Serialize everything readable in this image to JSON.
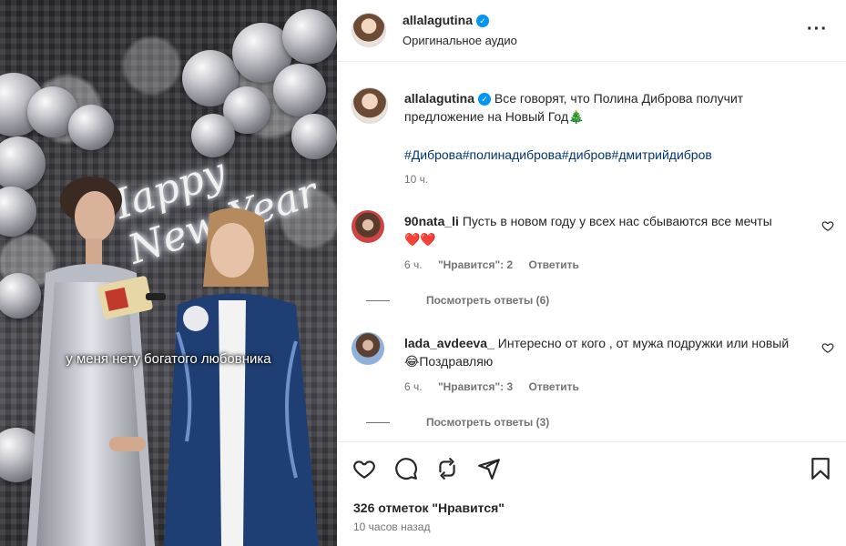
{
  "post": {
    "username": "allalagutina",
    "audio": "Оригинальное аудио",
    "video_caption": "у меня нету богатого любовника",
    "neon_sign": [
      "Happy",
      "New Year"
    ]
  },
  "caption": {
    "username": "allalagutina",
    "text": "Все говорят, что Полина Диброва получит предложение на Новый Год",
    "emoji": "🎄",
    "hashtags": "#Диброва#полинадиброва#дибров#дмитрийдибров",
    "time": "10 ч."
  },
  "comments": [
    {
      "username": "90nata_li",
      "text": "Пусть в новом году у всех нас сбываются все мечты",
      "emoji": "❤️❤️",
      "time": "6 ч.",
      "likes": "\"Нравится\": 2",
      "reply": "Ответить",
      "view_replies": "Посмотреть ответы (6)"
    },
    {
      "username": "lada_avdeeva_",
      "text": "Интересно от кого , от мужа подружки или новый",
      "emoji": "😂",
      "text_after": "Поздравляю",
      "time": "6 ч.",
      "likes": "\"Нравится\": 3",
      "reply": "Ответить",
      "view_replies": "Посмотреть ответы (3)"
    }
  ],
  "footer": {
    "likes": "326 отметок \"Нравится\"",
    "time": "10 часов назад"
  },
  "icons": {
    "header": [
      "verified-icon",
      "more-options-icon"
    ],
    "actions": [
      "heart-icon",
      "comment-icon",
      "repost-icon",
      "share-icon",
      "bookmark-icon"
    ],
    "comment": "like-comment-heart-icon"
  },
  "colors": {
    "verified": "#0095f6",
    "hashtag": "#00376b",
    "muted": "#737373",
    "text": "#262626"
  }
}
